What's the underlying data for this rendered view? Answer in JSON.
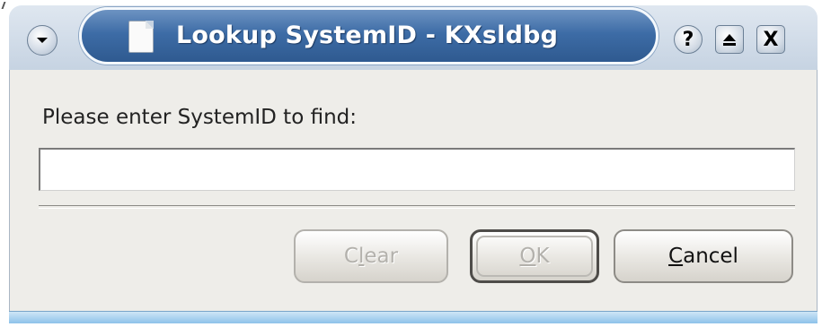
{
  "window": {
    "title": "Lookup SystemID - KXsldbg",
    "titlebar_buttons": {
      "menu_icon": "chevron-down-icon",
      "help": "?",
      "maximize_icon": "eject-icon",
      "close": "X"
    },
    "colors": {
      "title_gradient_top": "#6d93c2",
      "title_gradient_bottom": "#2f5a90",
      "client_background": "#eeede9"
    }
  },
  "dialog": {
    "prompt_label": "Please enter SystemID to find:",
    "input_value": "",
    "input_placeholder": ""
  },
  "buttons": {
    "clear": {
      "label": "Clear",
      "mnemonic": "l",
      "enabled": false
    },
    "ok": {
      "label": "OK",
      "mnemonic": "O",
      "enabled": false
    },
    "cancel": {
      "label": "Cancel",
      "mnemonic": "C",
      "enabled": true
    }
  }
}
